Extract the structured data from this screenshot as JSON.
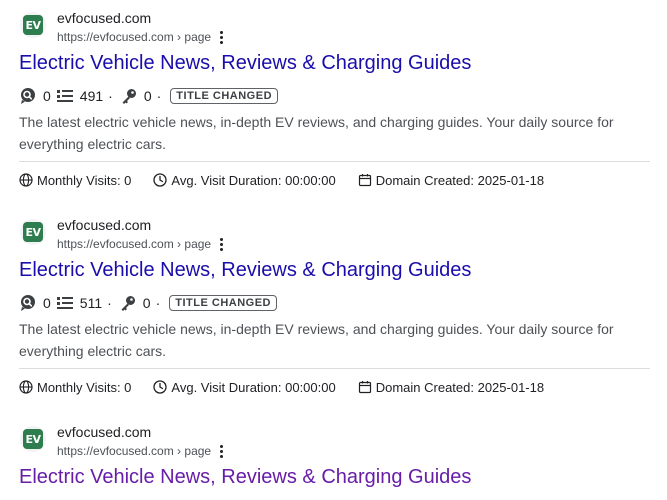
{
  "results": [
    {
      "site_name": "evfocused.com",
      "favicon_text": "EV",
      "url": "https://evfocused.com › page",
      "title": "Electric Vehicle News, Reviews & Charging Guides",
      "metrics": {
        "comments": "0",
        "words": "491",
        "keywords": "0",
        "badge": "TITLE CHANGED"
      },
      "snippet": "The latest electric vehicle news, in-depth EV reviews, and charging guides. Your daily source for everything electric cars.",
      "stats": {
        "monthly_visits": "Monthly Visits: 0",
        "avg_visit_duration": "Avg. Visit Duration: 00:00:00",
        "domain_created": "Domain Created: 2025-01-18"
      }
    },
    {
      "site_name": "evfocused.com",
      "favicon_text": "EV",
      "url": "https://evfocused.com › page",
      "title": "Electric Vehicle News, Reviews & Charging Guides",
      "metrics": {
        "comments": "0",
        "words": "511",
        "keywords": "0",
        "badge": "TITLE CHANGED"
      },
      "snippet": "The latest electric vehicle news, in-depth EV reviews, and charging guides. Your daily source for everything electric cars.",
      "stats": {
        "monthly_visits": "Monthly Visits: 0",
        "avg_visit_duration": "Avg. Visit Duration: 00:00:00",
        "domain_created": "Domain Created: 2025-01-18"
      }
    },
    {
      "site_name": "evfocused.com",
      "favicon_text": "EV",
      "url": "https://evfocused.com › page",
      "title": "Electric Vehicle News, Reviews & Charging Guides",
      "title_visited": true
    }
  ],
  "colors": {
    "link": "#1a0dab",
    "visited_link": "#681da8",
    "favicon_bg": "#2e7d4f"
  },
  "icons": {
    "comments": "search-bubble-icon",
    "words": "list-icon",
    "keywords": "key-icon",
    "monthly_visits": "globe-icon",
    "avg_visit_duration": "clock-icon",
    "domain_created": "calendar-icon",
    "more": "more-vert-icon"
  }
}
